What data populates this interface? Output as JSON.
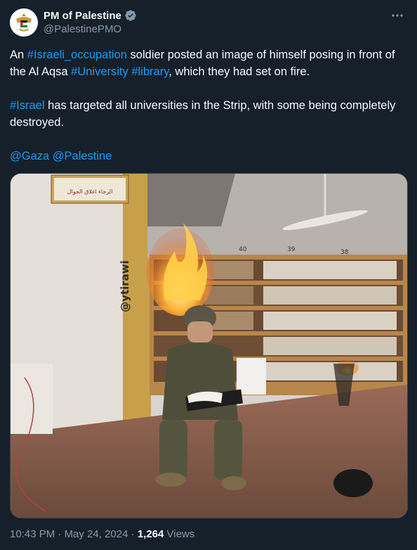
{
  "author": {
    "name": "PM of Palestine",
    "handle": "@PalestinePMO",
    "verified_icon": "verified-badge-icon"
  },
  "more_icon": "more-horizontal-icon",
  "tweet": {
    "p1_part1": "An ",
    "p1_tag1": "#Israeli_occupation",
    "p1_part2": " soldier posted an image of himself posing in front of the Al Aqsa ",
    "p1_tag2": "#University",
    "p1_part3": " ",
    "p1_tag3": "#library",
    "p1_part4": ", which they had set on fire.",
    "p2_tag": "#Israel",
    "p2_rest": " has targeted all universities in the Strip, with some being completely destroyed.",
    "p3_tag1": "@Gaza",
    "p3_sep": " ",
    "p3_tag2": "@Palestine"
  },
  "media": {
    "watermark": "@ytirawi",
    "sign_text": "الرجاء اغلاق الجوال",
    "shelf_number_1": "39",
    "shelf_number_2": "38",
    "shelf_number_3": "40"
  },
  "meta": {
    "time": "10:43 PM",
    "separator": " · ",
    "date": "May 24, 2024",
    "views_count": "1,264",
    "views_label": " Views"
  },
  "colors": {
    "background": "#15202b",
    "link": "#1d9bf0",
    "secondary": "#8b98a5",
    "verified": "#829aab"
  }
}
